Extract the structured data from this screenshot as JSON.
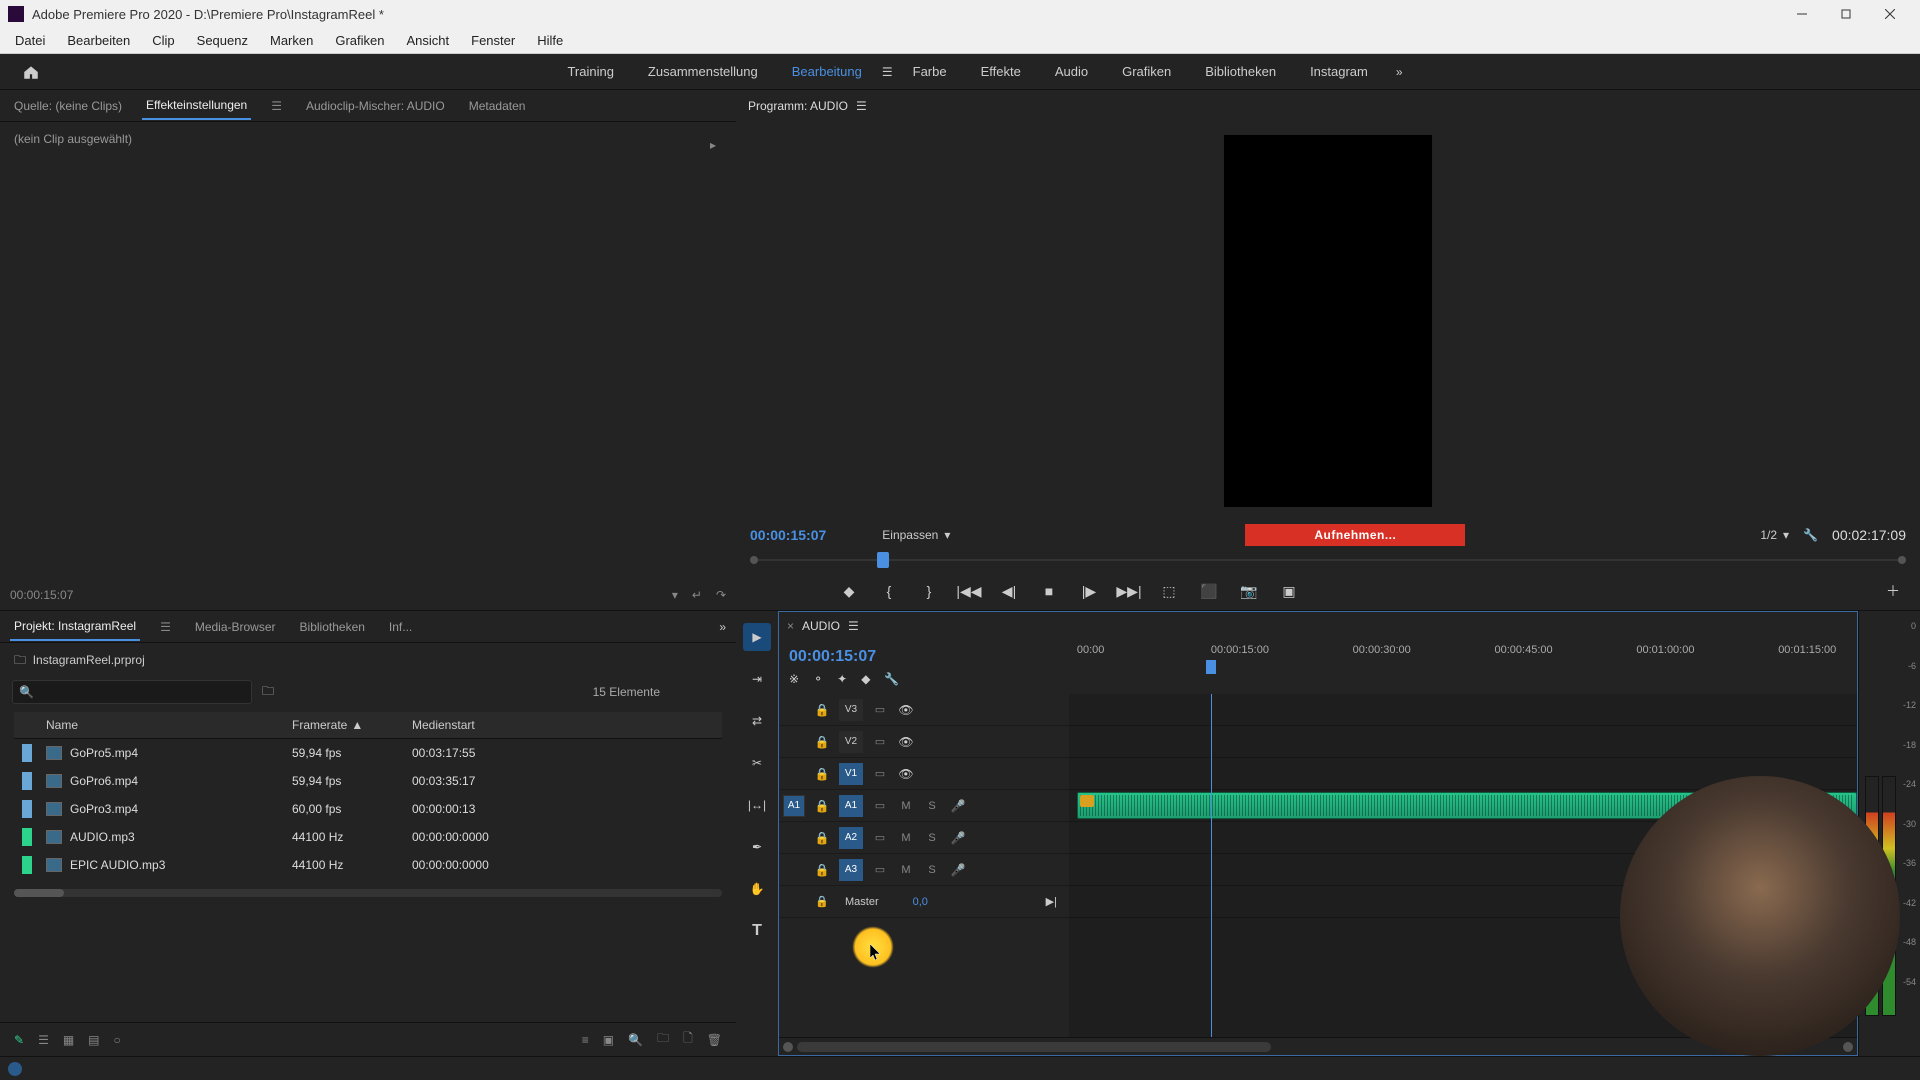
{
  "window": {
    "title": "Adobe Premiere Pro 2020 - D:\\Premiere Pro\\InstagramReel *"
  },
  "menu": [
    "Datei",
    "Bearbeiten",
    "Clip",
    "Sequenz",
    "Marken",
    "Grafiken",
    "Ansicht",
    "Fenster",
    "Hilfe"
  ],
  "workspaces": {
    "items": [
      "Training",
      "Zusammenstellung",
      "Bearbeitung",
      "Farbe",
      "Effekte",
      "Audio",
      "Grafiken",
      "Bibliotheken",
      "Instagram"
    ],
    "active": "Bearbeitung"
  },
  "source": {
    "tabs": [
      "Quelle: (keine Clips)",
      "Effekteinstellungen",
      "Audioclip-Mischer: AUDIO",
      "Metadaten"
    ],
    "active": 1,
    "no_clip_text": "(kein Clip ausgewählt)",
    "timecode": "00:00:15:07"
  },
  "project": {
    "tabs": [
      "Projekt: InstagramReel",
      "Media-Browser",
      "Bibliotheken",
      "Inf..."
    ],
    "project_name": "InstagramReel.prproj",
    "element_count": "15 Elemente",
    "columns": [
      "Name",
      "Framerate",
      "Medienstart"
    ],
    "rows": [
      {
        "color": "#6aa7d6",
        "name": "GoPro5.mp4",
        "framerate": "59,94 fps",
        "start": "00:03:17:55"
      },
      {
        "color": "#6aa7d6",
        "name": "GoPro6.mp4",
        "framerate": "59,94 fps",
        "start": "00:03:35:17"
      },
      {
        "color": "#6aa7d6",
        "name": "GoPro3.mp4",
        "framerate": "60,00 fps",
        "start": "00:00:00:13"
      },
      {
        "color": "#2bd48a",
        "name": "AUDIO.mp3",
        "framerate": "44100 Hz",
        "start": "00:00:00:0000"
      },
      {
        "color": "#2bd48a",
        "name": "EPIC AUDIO.mp3",
        "framerate": "44100 Hz",
        "start": "00:00:00:0000"
      }
    ]
  },
  "program": {
    "panel_title": "Programm: AUDIO",
    "timecode": "00:00:15:07",
    "fit": "Einpassen",
    "recording_label": "Aufnehmen...",
    "zoom": "1/2",
    "duration": "00:02:17:09"
  },
  "timeline": {
    "sequence_tab": "AUDIO",
    "timecode": "00:00:15:07",
    "ruler": [
      "00:00",
      "00:00:15:00",
      "00:00:30:00",
      "00:00:45:00",
      "00:01:00:00",
      "00:01:15:00"
    ],
    "tracks": {
      "video": [
        "V3",
        "V2",
        "V1"
      ],
      "audio": [
        "A1",
        "A2",
        "A3"
      ],
      "v_active": "V1",
      "a_source": "A1",
      "master_label": "Master",
      "master_value": "0,0"
    },
    "mute_label": "M",
    "solo_label": "S"
  },
  "meters": {
    "scale": [
      "0",
      "-6",
      "-12",
      "-18",
      "-24",
      "-30",
      "-36",
      "-42",
      "-48",
      "-54"
    ]
  }
}
